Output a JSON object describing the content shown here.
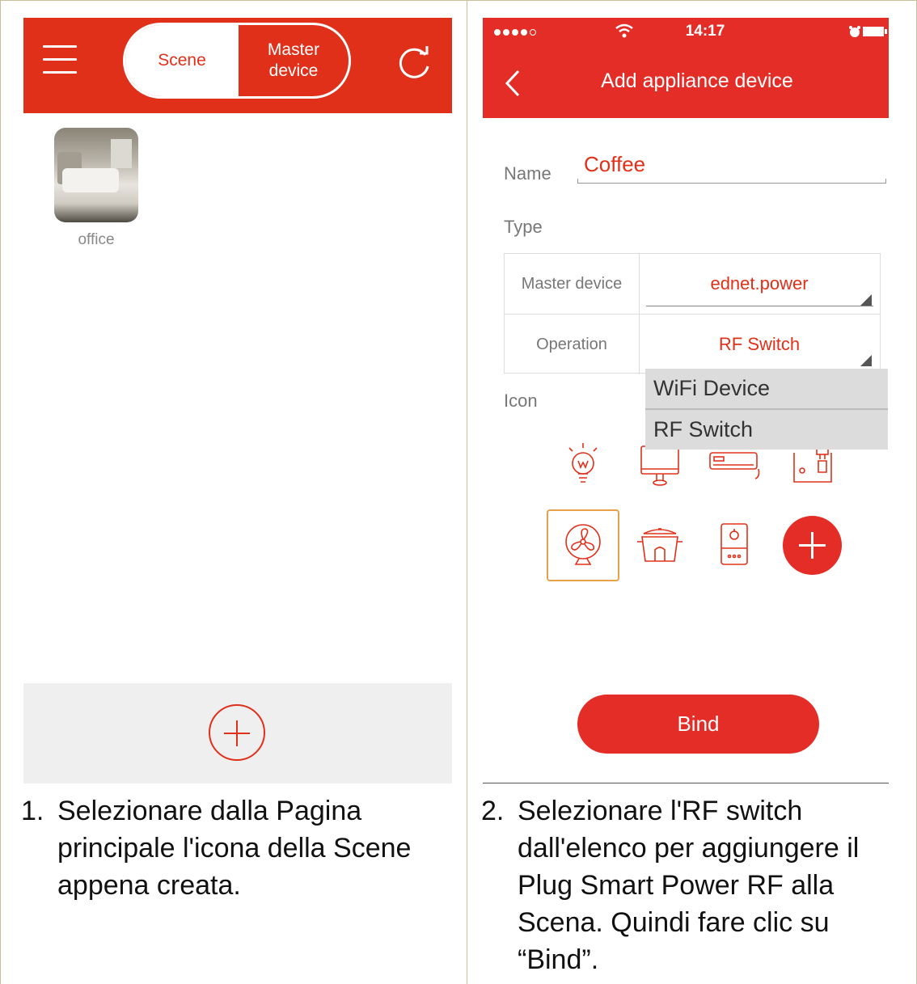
{
  "left_panel": {
    "segment": {
      "scene_label": "Scene",
      "master_label": "Master\ndevice"
    },
    "scene_item": {
      "label": "office"
    }
  },
  "right_panel": {
    "status_bar": {
      "time": "14:17"
    },
    "title": "Add appliance device",
    "form": {
      "name_label": "Name",
      "name_value": "Coffee",
      "type_label": "Type",
      "master_device_key": "Master device",
      "master_device_value": "ednet.power",
      "operation_key": "Operation",
      "operation_value": "RF Switch",
      "icon_label": "Icon"
    },
    "dropdown_options": [
      "WiFi Device",
      "RF Switch"
    ],
    "icons": [
      "bulb-icon",
      "monitor-icon",
      "air-conditioner-icon",
      "coffee-machine-icon",
      "fan-icon",
      "rice-cooker-icon",
      "water-heater-icon"
    ],
    "selected_icon": "fan-icon",
    "bind_label": "Bind"
  },
  "captions": {
    "step1_num": "1.",
    "step1_text": "Selezionare dalla Pagina\nprincipale l'icona della Scene\nappena creata.",
    "step2_num": "2.",
    "step2_text": "Selezionare l'RF switch\ndall'elenco per aggiungere il\nPlug Smart Power RF alla\nScena. Quindi fare clic su\n“Bind”."
  },
  "colors": {
    "accent_red": "#e1301a",
    "selected_border": "#e8a04a"
  }
}
